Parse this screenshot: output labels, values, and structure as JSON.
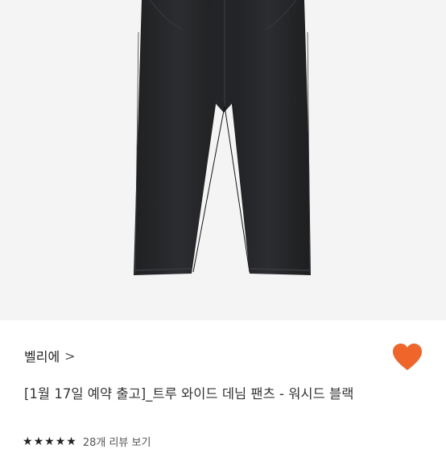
{
  "product": {
    "image_alt": "black wide denim pants",
    "brand": "벨리에",
    "brand_chevron": ">",
    "title": "[1월 17일 예약 출고]_트루 와이드 데님 팬츠 - 워시드 블랙",
    "rating": {
      "stars": 5,
      "star_glyph": "★",
      "review_text": "28개 리뷰 보기"
    },
    "wishlist_color": "#f0652a"
  }
}
